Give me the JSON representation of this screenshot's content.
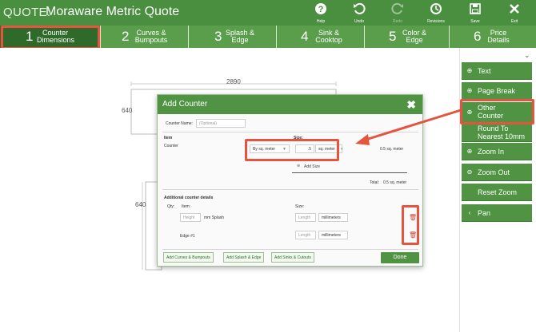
{
  "window": {
    "title_prefix": "QUOTE:",
    "title": "Moraware Metric Quote"
  },
  "toolbar": {
    "help": "Help",
    "undo": "Undo",
    "redo": "Redo",
    "revisions": "Revisions",
    "save": "Save",
    "exit": "Exit"
  },
  "steps": [
    {
      "num": "1",
      "label": "Counter Dimensions"
    },
    {
      "num": "2",
      "label": "Curves & Bumpouts"
    },
    {
      "num": "3",
      "label": "Splash & Edge"
    },
    {
      "num": "4",
      "label": "Sink & Cooktop"
    },
    {
      "num": "5",
      "label": "Color & Edge"
    },
    {
      "num": "6",
      "label": "Price Details"
    }
  ],
  "canvas": {
    "dim_top": "2890",
    "dim_left_1": "640",
    "dim_left_2": "640"
  },
  "modal": {
    "title": "Add Counter",
    "close": "✖",
    "counter_name_label": "Counter Name:",
    "counter_name_placeholder": "(Optional)",
    "item_header": "Item",
    "size_header": "Size:",
    "item_name": "Counter",
    "measure_select": "By sq. meter",
    "size_value": ".5",
    "unit_select": "sq. meter",
    "item_total": "0.5 sq. meter",
    "add_size": "Add Size",
    "total_label": "Total:",
    "total_value": "0.5 sq. meter",
    "additional_header": "Additional counter details",
    "qty_label": "Qty:",
    "item_label": "Item:",
    "size_label2": "Size:",
    "row1_height_placeholder": "Height",
    "row1_item": "mm Splash",
    "row1_length_placeholder": "Length",
    "row1_unit": "millimeters",
    "row2_item": "Edge #1",
    "row2_length_placeholder": "Length",
    "row2_unit": "millimeters",
    "btn_curves": "Add Curves & Bumpouts",
    "btn_splash": "Add Splash & Edge",
    "btn_sinks": "Add Sinks & Cutouts",
    "btn_done": "Done"
  },
  "side_panel": {
    "items": [
      {
        "label": "Text",
        "icon": "plus-circle-icon"
      },
      {
        "label": "Page Break",
        "icon": "plus-circle-icon"
      },
      {
        "label": "Other Counter",
        "icon": "plus-circle-icon"
      },
      {
        "label": "Round To Nearest 10mm",
        "icon": ""
      },
      {
        "label": "Zoom In",
        "icon": "zoom-in-icon"
      },
      {
        "label": "Zoom Out",
        "icon": "zoom-out-icon"
      },
      {
        "label": "Reset Zoom",
        "icon": ""
      },
      {
        "label": "Pan",
        "icon": "chevron-left-icon"
      }
    ]
  },
  "colors": {
    "brand_green": "#4a8f3f",
    "active_tab": "#2f6a2a",
    "highlight_red": "#e5543f"
  }
}
